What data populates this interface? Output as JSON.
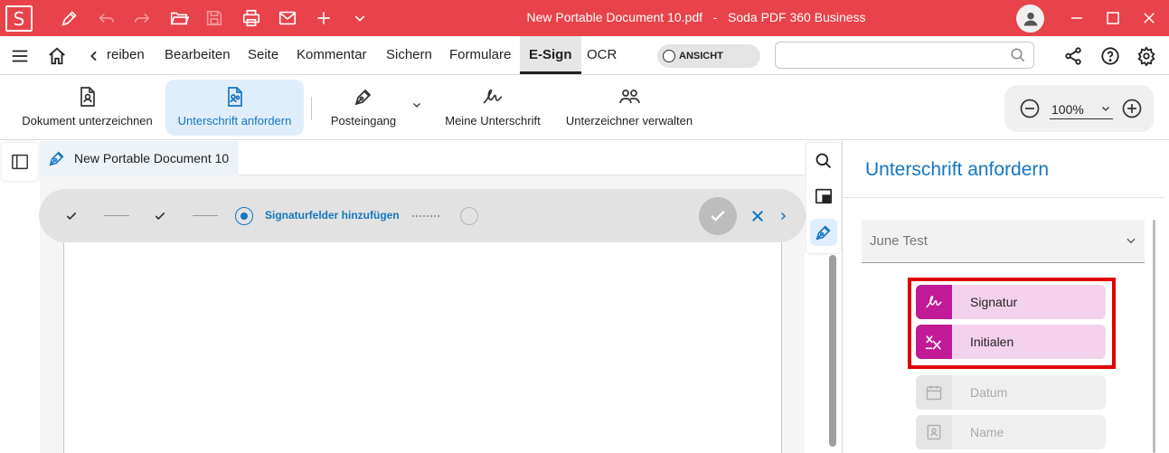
{
  "titlebar": {
    "app_logo": "S",
    "document_title": "New Portable Document 10.pdf   -   Soda PDF 360 Business",
    "color": "#e8424a"
  },
  "menubar": {
    "items": [
      "reiben",
      "Bearbeiten",
      "Seite",
      "Kommentar",
      "Sichern",
      "Formulare",
      "E-Sign",
      "OCR"
    ],
    "active": "E-Sign",
    "view_toggle": "ANSICHT",
    "search_placeholder": ""
  },
  "ribbon": {
    "buttons": [
      {
        "label": "Dokument unterzeichnen",
        "icon": "document-user-icon"
      },
      {
        "label": "Unterschrift anfordern",
        "icon": "request-signature-icon",
        "active": true
      },
      {
        "label": "Posteingang",
        "icon": "pen-nib-icon"
      },
      {
        "label": "Meine Unterschrift",
        "icon": "signature-scribble-icon"
      },
      {
        "label": "Unterzeichner verwalten",
        "icon": "people-icon"
      }
    ],
    "zoom": "100%"
  },
  "document": {
    "tab_title": "New Portable Document 10"
  },
  "steps": {
    "current_label": "Signaturfelder hinzufügen",
    "completed": 2,
    "total": 4
  },
  "right_panel": {
    "title": "Unterschrift anfordern",
    "signer": "June Test",
    "fields": [
      {
        "label": "Signatur",
        "icon": "signature-icon",
        "state": "active"
      },
      {
        "label": "Initialen",
        "icon": "initials-icon",
        "state": "active"
      },
      {
        "label": "Datum",
        "icon": "calendar-icon",
        "state": "disabled"
      },
      {
        "label": "Name",
        "icon": "id-card-icon",
        "state": "disabled"
      }
    ]
  },
  "colors": {
    "accent": "#1576c2",
    "brand": "#e8424a",
    "field_active": "#c01a96",
    "highlight": "#e00000"
  }
}
